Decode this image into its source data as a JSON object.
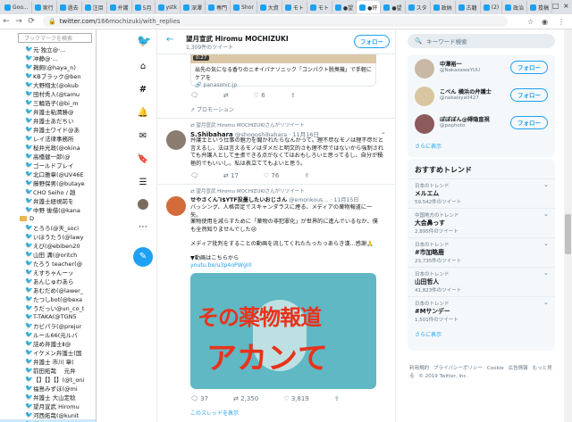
{
  "tabs": [
    "Goo...",
    "実行",
    "過去",
    "注目",
    "弁護",
    "5月",
    "ystk",
    "深澤",
    "専門",
    "Shor",
    "大資",
    "モト",
    "モト",
    "●望",
    "●旰",
    "●望",
    "スタ",
    "政納",
    "古籍",
    "(2)",
    "政治",
    "投稿"
  ],
  "address": {
    "prefix": "twitter.com/",
    "path": "166mochizuki/with_replies"
  },
  "sidebar": {
    "search_placeholder": "ブックマークを検索",
    "items": [
      "元·独立@·...",
      "冲静@·...",
      "鵜飼(@haya_n)",
      "KBブラック@ben",
      "大野翔太(@okub",
      "田村秀人(@tamu",
      "三輪箔子(@bi_m",
      "弁護士粘潤勝@",
      "弁護士あだちい",
      "弁護士ワイド@あ",
      "レイ法律事務所",
      "桜井光政(@okina",
      "高橋健一郎(@",
      "ゴールドプレイ",
      "北口雅章(@UV46E",
      "藤野保男(@butaye",
      "CHO Seiho / 趙",
      "弁護士経視前を",
      "中野 後借(@kana",
      "",
      "とろろ(@天_soci",
      "いほうたう(@lawy",
      "えび(@ebiben20",
      "山田 溝(@oritch",
      "たろう teacher(@",
      "えすちゃんーッ",
      "あんじゅわあら",
      "あむだめ(@lawer_",
      "たつしbot(@bexa",
      "うだっい@un_co_t",
      "T-TAKA(@TGN5",
      "カビパラ(@prejur",
      "ルール66(元ルバ",
      "詰め弁護士Ⅱ@",
      "イケメン弁護士(国",
      "弁護士 市川 章(",
      "前田拓哉 　元弁",
      "【】【】【】(@t_oni",
      "福島みずほ(@mi",
      "弁護士 大山定稔",
      "望月宣武 Hiromu",
      "河西拓哉(@kunit",
      "井上正昭(@iinou"
    ]
  },
  "nav": {
    "icons": [
      "twitter-bird",
      "home",
      "hashtag",
      "bell",
      "mail",
      "bookmark",
      "list",
      "profile",
      "more",
      "tweet"
    ]
  },
  "header": {
    "name": "望月宣武 Hiromu MOCHIZUKI",
    "count": "1,309件のツイート",
    "follow": "フォロー"
  },
  "tweets": [
    {
      "video_time": "0:27",
      "text": "出先の気になる香りのニオイパナソニック「コンパクト脱臭機」で手軽にケアを",
      "link": "panasonic.jp",
      "likes": "6",
      "promo": "プロモーション"
    },
    {
      "rt_by": "望月宣武 Hiromu MOCHIZUKIさんがリツイート",
      "name": "S.Shibahara",
      "handle": "@shogoshibahara · 11月16日",
      "text": "弁護士という仕事の魅力を聞かれたらなんかって。理不尽なモノは理不尽だと言えるし、法は言えるモノはダメだと明文的さも理不尽ではないから強制されても弁護人として主張できる点がなくてはおもしろいと思ってるし、自分が積極的でもいいし。私は表立ててもよいと思う。",
      "replies": "",
      "rts": "17",
      "likes": "76"
    },
    {
      "rt_by": "望月宣武 Hiromu MOCHIZUKIさんがリツイート",
      "name": "せやさくんἼ$YTF投墨したいおじさん",
      "handle": "@emonkous… · 11月15日",
      "text1": "バッシング、人格否定でスキャンダラスに煙る、メディアの薬物報道に一矢。",
      "text2": "薬物使用を減らすために「薬物の非犯罪化」が世界的に進んでいるなか、僕も全然知りませんでした😢",
      "text3": "メディア批判をすることの動画を流してくれたたったっあらき漢…感謝🙏",
      "text4": "▼動画はこちらから",
      "link": "youtu.be/u3p4oPWgI0",
      "img_line1": "その薬物報道",
      "img_line2": "アカンて",
      "replies": "37",
      "rts": "2,350",
      "likes": "3,819",
      "thread": "このスレッドを表示"
    }
  ],
  "right": {
    "search": "キーワード検索",
    "wtf": [
      {
        "name": "中澤裕一",
        "handle": "@NakazawaYUU",
        "btn": "フォロー"
      },
      {
        "name": "こべん 横浜の弁護士",
        "handle": "@nakaisya0427",
        "btn": "フォロー"
      },
      {
        "name": "ぽぽぽん@碍隐直視",
        "handle": "@pophoto",
        "btn": "フォロー"
      }
    ],
    "more": "さらに表示",
    "trends_title": "おすすめトレンド",
    "trends": [
      {
        "cat": "日本のトレンド",
        "name": "メルエム",
        "count": "59,542件のツイート"
      },
      {
        "cat": "中国地方のトレンド",
        "name": "大会鼻っす",
        "count": "2,895件のツイート"
      },
      {
        "cat": "日本のトレンド",
        "name": "#市加略鹿",
        "count": "23,735件のツイート"
      },
      {
        "cat": "日本のトレンド",
        "name": "山田哲人",
        "count": "41,823件のツイート"
      },
      {
        "cat": "日本のトレンド",
        "name": "#Mサンデー",
        "count": "1,501件のツイート"
      }
    ],
    "footer": [
      "利用規約",
      "プライバシーポリシー",
      "Cookie",
      "広告情報",
      "もっと見る",
      "© 2019 Twitter, Inc."
    ]
  }
}
